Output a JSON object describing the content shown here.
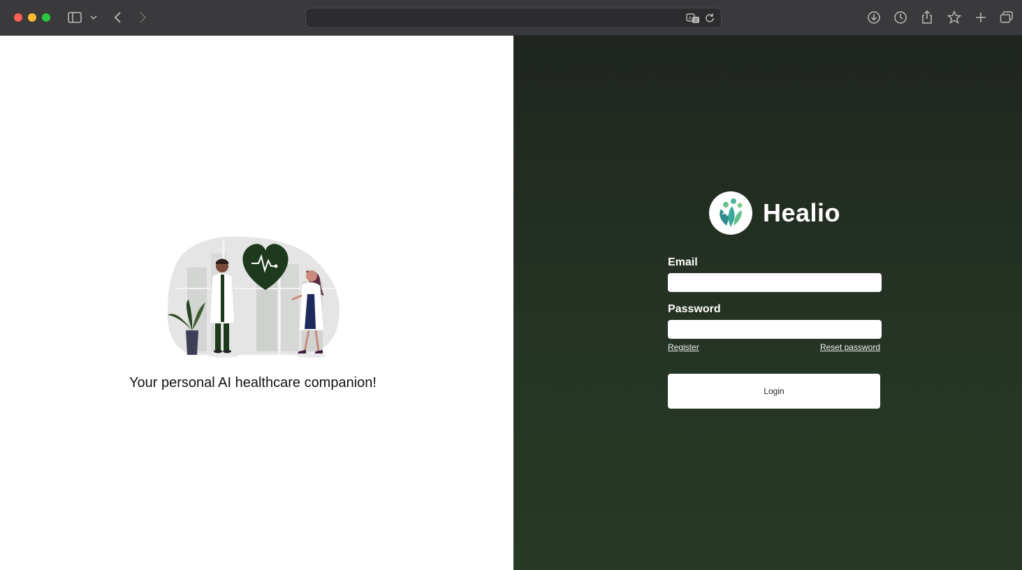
{
  "browser": {
    "address_value": "",
    "icons": [
      "sidebar-icon",
      "chevron-down-icon",
      "back-icon",
      "forward-icon",
      "translate-icon",
      "reload-icon",
      "download-icon",
      "history-icon",
      "share-icon",
      "bookmark-star-icon",
      "new-tab-icon",
      "tab-overview-icon"
    ]
  },
  "left_panel": {
    "tagline": "Your personal AI healthcare companion!",
    "colors": {
      "heart": "#1e3a1c",
      "background": "#ffffff"
    }
  },
  "login": {
    "brand_name": "Healio",
    "email_label": "Email",
    "email_value": "",
    "password_label": "Password",
    "password_value": "",
    "register_label": "Register",
    "reset_label": "Reset password",
    "login_label": "Login",
    "colors": {
      "panel_top": "#202520",
      "panel_bottom": "#263a24",
      "logo_teal": "#3aa89a",
      "logo_green": "#6cc08a"
    }
  }
}
